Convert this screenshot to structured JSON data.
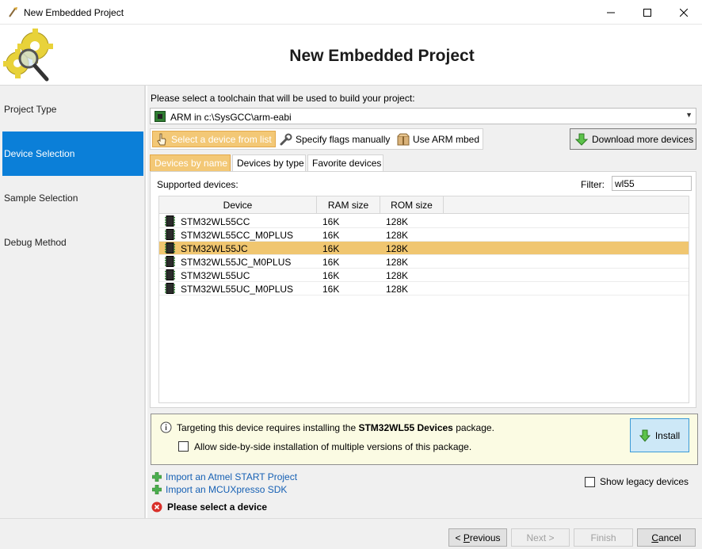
{
  "window": {
    "title": "New Embedded Project"
  },
  "header": {
    "heading": "New Embedded Project"
  },
  "sidebar": {
    "items": [
      {
        "label": "Project Type",
        "active": false
      },
      {
        "label": "Device Selection",
        "active": true
      },
      {
        "label": "Sample Selection",
        "active": false
      },
      {
        "label": "Debug Method",
        "active": false
      }
    ]
  },
  "toolchain": {
    "prompt": "Please select a toolchain that will be used to build your project:",
    "selected": "ARM in c:\\SysGCC\\arm-eabi"
  },
  "modes": {
    "select_from_list": "Select a device from list",
    "specify_flags": "Specify flags manually",
    "use_mbed": "Use ARM mbed",
    "download_more": "Download more devices"
  },
  "tabs": {
    "by_name": "Devices by name",
    "by_type": "Devices by type",
    "favorites": "Favorite devices"
  },
  "devices": {
    "supported_label": "Supported devices:",
    "filter_label": "Filter:",
    "filter_value": "wl55",
    "columns": {
      "device": "Device",
      "ram": "RAM size",
      "rom": "ROM size"
    },
    "rows": [
      {
        "device": "STM32WL55CC",
        "ram": "16K",
        "rom": "128K",
        "selected": false
      },
      {
        "device": "STM32WL55CC_M0PLUS",
        "ram": "16K",
        "rom": "128K",
        "selected": false
      },
      {
        "device": "STM32WL55JC",
        "ram": "16K",
        "rom": "128K",
        "selected": true
      },
      {
        "device": "STM32WL55JC_M0PLUS",
        "ram": "16K",
        "rom": "128K",
        "selected": false
      },
      {
        "device": "STM32WL55UC",
        "ram": "16K",
        "rom": "128K",
        "selected": false
      },
      {
        "device": "STM32WL55UC_M0PLUS",
        "ram": "16K",
        "rom": "128K",
        "selected": false
      }
    ]
  },
  "notice": {
    "text_before": "Targeting this device requires installing the ",
    "package_name": "STM32WL55 Devices",
    "text_after": " package.",
    "side_by_side_label": "Allow side-by-side installation of multiple versions of this package.",
    "side_by_side_checked": false,
    "install_label": "Install"
  },
  "links": {
    "import_atmel": "Import an Atmel START Project",
    "import_mcux": "Import an MCUXpresso SDK"
  },
  "legacy": {
    "label": "Show legacy devices",
    "checked": false
  },
  "error": {
    "message": "Please select a device"
  },
  "footer": {
    "previous_prefix": "< ",
    "previous_key": "P",
    "previous_rest": "revious",
    "next_label": "Next >",
    "finish_label": "Finish",
    "cancel_key": "C",
    "cancel_rest": "ancel"
  },
  "colors": {
    "accent_blue": "#0b7fd8",
    "selection_gold": "#f0c670",
    "link_blue": "#1660b4",
    "notice_bg": "#fbfbe3"
  }
}
